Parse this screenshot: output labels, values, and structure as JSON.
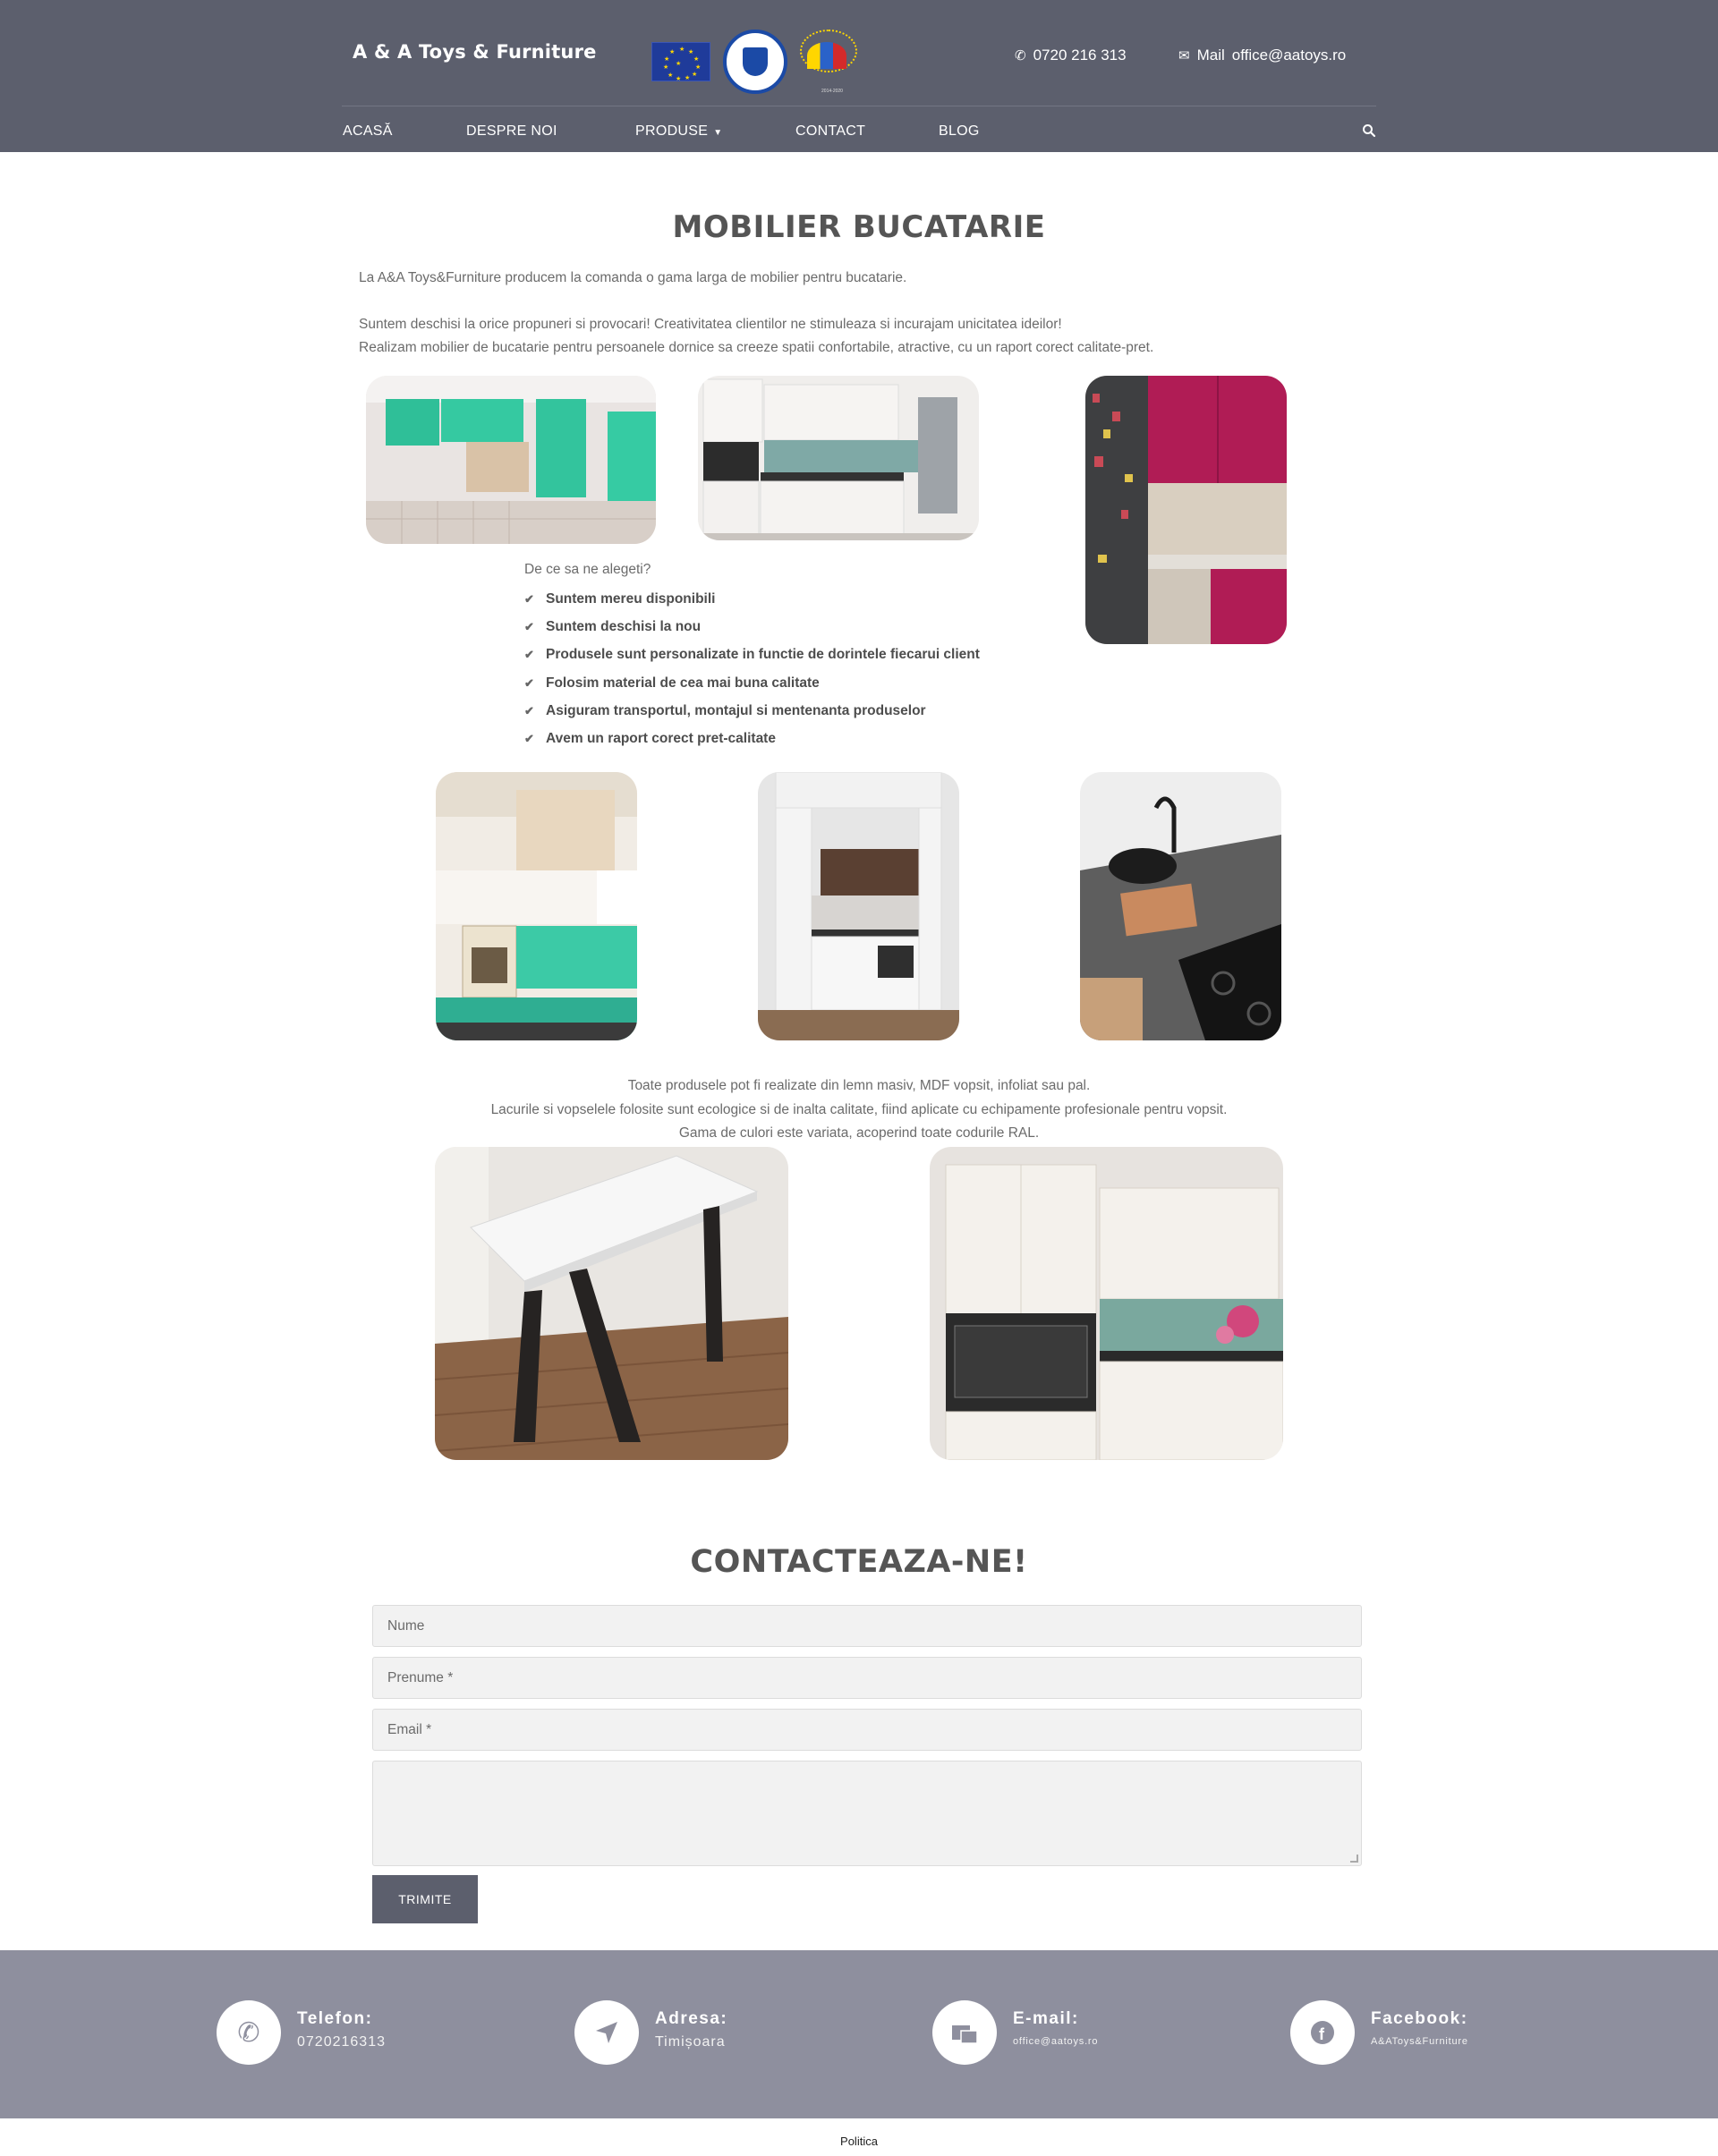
{
  "header": {
    "brand": "A & A Toys & Furniture",
    "phone": "0720 216 313",
    "mail_label": "Mail",
    "mail_value": "office@aatoys.ro",
    "cohesion_caption": "2014-2020"
  },
  "nav": {
    "items": [
      "ACASĂ",
      "DESPRE NOI",
      "PRODUSE",
      "CONTACT",
      "BLOG"
    ]
  },
  "main": {
    "title": "MOBILIER BUCATARIE",
    "intro": "La A&A Toys&Furniture producem la comanda o gama larga de mobilier pentru bucatarie.",
    "line2": "Suntem deschisi la orice propuneri si provocari! Creativitatea clientilor ne stimuleaza si incurajam unicitatea ideilor!",
    "line3": "Realizam mobilier de bucatarie pentru persoanele dornice sa creeze spatii confortabile, atractive, cu un raport corect calitate-pret.",
    "why_title": "De ce sa ne alegeti?",
    "why": [
      "Suntem mereu disponibili",
      "Suntem deschisi la nou",
      "Produsele sunt personalizate in functie de dorintele fiecarui client",
      "Folosim material de cea mai buna calitate",
      "Asiguram transportul, montajul si mentenanta produselor",
      "Avem un raport corect pret-calitate"
    ],
    "materials_1": "Toate produsele pot fi realizate din lemn masiv, MDF vopsit, infoliat sau pal.",
    "materials_2": "Lacurile si vopselele folosite sunt ecologice si de inalta calitate, fiind aplicate cu echipamente profesionale pentru vopsit.",
    "materials_3": "Gama de culori este variata, acoperind toate codurile RAL."
  },
  "contact": {
    "title": "CONTACTEAZA-NE!",
    "name_placeholder": "Nume",
    "firstname_placeholder": "Prenume *",
    "email_placeholder": "Email *",
    "submit": "TRIMITE"
  },
  "footer": {
    "phone_label": "Telefon:",
    "phone_value": "0720216313",
    "address_label": "Adresa:",
    "address_value": "Timișoara",
    "email_label": "E-mail:",
    "email_value": "office@aatoys.ro",
    "facebook_label": "Facebook:",
    "facebook_value": "A&AToys&Furniture",
    "policy": "Politica"
  },
  "colors": {
    "header_bg": "#5c5f6d",
    "footer_bg": "#8e8f9e",
    "button_bg": "#5c5f6d"
  }
}
